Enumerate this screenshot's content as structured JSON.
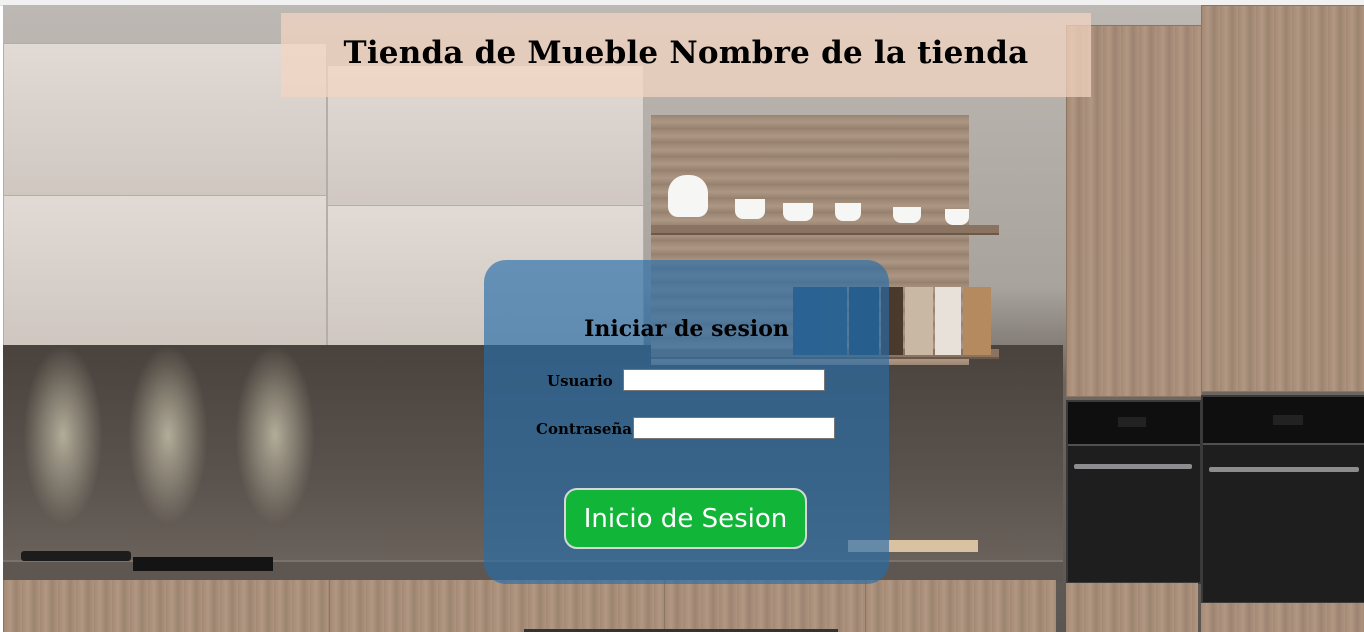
{
  "header": {
    "title": "Tienda de Mueble Nombre de la tienda"
  },
  "login": {
    "title": "Iniciar de sesion",
    "username_label": "Usuario",
    "username_value": "",
    "password_label": "Contraseña",
    "password_value": "",
    "submit_label": "Inicio de Sesion"
  },
  "colors": {
    "banner": "#f4d6c2",
    "panel": "#286eaa",
    "button": "#11b638"
  },
  "background": {
    "subject": "kitchen-photo"
  }
}
